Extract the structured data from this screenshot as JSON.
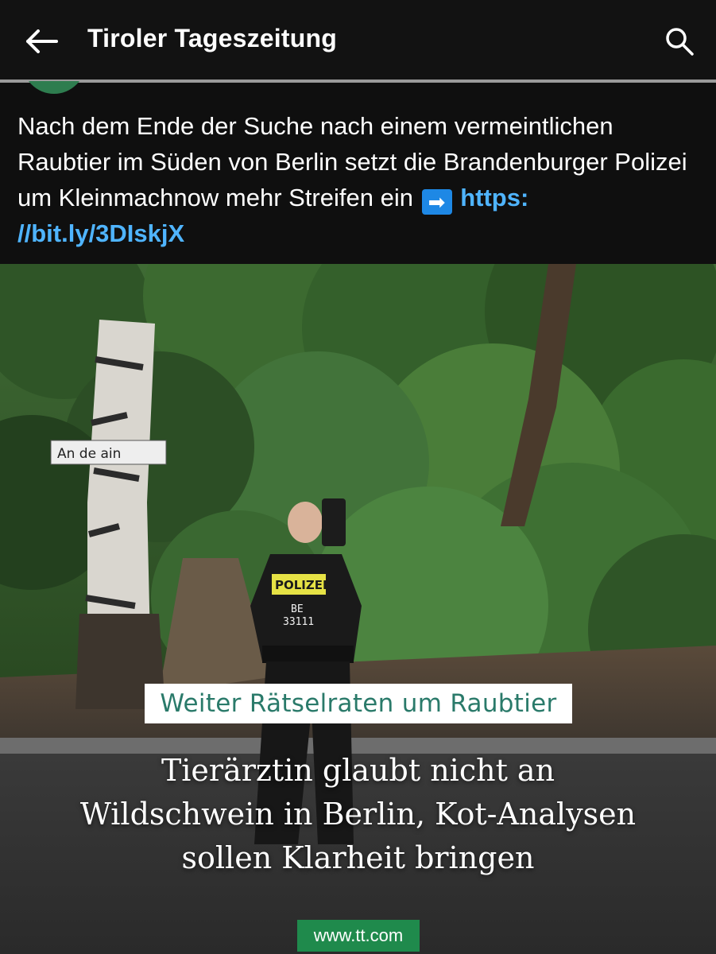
{
  "header": {
    "title": "Tiroler Tageszeitung",
    "back_icon": "arrow-left-icon",
    "search_icon": "search-icon"
  },
  "post": {
    "text": "Nach dem Ende der Suche nach einem vermeintlichen Raubtier im Süden von Berlin setzt die Brandenburger Polizei um Kleinmachnow mehr Streifen ein",
    "arrow_glyph": "➡",
    "link": "https://bit.ly/3DIskjX",
    "link_line1": "https:",
    "link_line2": "//bit.ly/3DIskjX"
  },
  "image": {
    "sign_text": "An de       ain",
    "vest_label": "POLIZEI",
    "vest_id_line1": "BE",
    "vest_id_line2": "33111",
    "kicker": "Weiter Rätselraten um Raubtier",
    "headline_line1": "Tierärztin glaubt nicht an",
    "headline_line2": "Wildschwein in Berlin, Kot-Analysen",
    "headline_line3": "sollen Klarheit bringen",
    "source": "www.tt.com"
  },
  "colors": {
    "background": "#0f0f0f",
    "link": "#4fb4ff",
    "kicker_text": "#2a7a6a",
    "source_badge": "#1f8a4c"
  }
}
